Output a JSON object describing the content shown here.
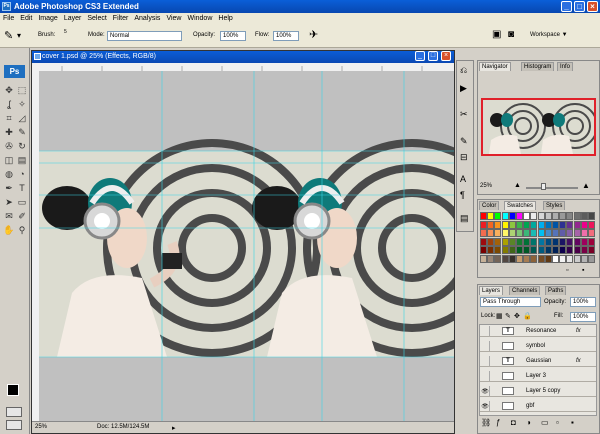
{
  "window": {
    "app_icon": "Ps",
    "title": "Adobe Photoshop CS3 Extended",
    "controls": {
      "minimize": "_",
      "maximize": "□",
      "close": "×"
    }
  },
  "menu": {
    "items": [
      "File",
      "Edit",
      "Image",
      "Layer",
      "Select",
      "Filter",
      "Analysis",
      "View",
      "Window",
      "Help"
    ]
  },
  "options": {
    "brush_label": "Brush:",
    "brush_size": "5",
    "mode_label": "Mode:",
    "mode_value": "Normal",
    "opacity_label": "Opacity:",
    "opacity_value": "100%",
    "flow_label": "Flow:",
    "flow_value": "100%",
    "workspace_label": "Workspace ▼"
  },
  "tools": {
    "logo": "Ps",
    "icons": [
      "move-icon",
      "marquee-icon",
      "lasso-icon",
      "magic-wand-icon",
      "crop-icon",
      "slice-icon",
      "healing-icon",
      "brush-icon",
      "stamp-icon",
      "history-brush-icon",
      "eraser-icon",
      "gradient-icon",
      "blur-icon",
      "dodge-icon",
      "pen-icon",
      "type-icon",
      "path-select-icon",
      "shape-icon",
      "notes-icon",
      "eyedropper-icon",
      "hand-icon",
      "zoom-icon"
    ],
    "glyphs": [
      "✥",
      "⬚",
      "ʆ",
      "✧",
      "⌗",
      "◿",
      "✚",
      "✎",
      "✇",
      "↻",
      "◫",
      "▤",
      "◍",
      "◔",
      "✒",
      "T",
      "➤",
      "▭",
      "✉",
      "✐",
      "✋",
      "⚲"
    ]
  },
  "document": {
    "tab_title": "cover 1.psd @ 25% (Effects, RGB/8)",
    "zoom": "25%",
    "doc_size": "Doc: 12.5M/124.5M"
  },
  "navigator": {
    "tabs": [
      "Navigator",
      "Histogram",
      "Info"
    ],
    "zoom": "25%"
  },
  "swatches": {
    "tabs": [
      "Color",
      "Swatches",
      "Styles"
    ],
    "colors": [
      "#ff0000",
      "#ffff00",
      "#00ff00",
      "#00ffff",
      "#0000ff",
      "#ff00ff",
      "#ffffff",
      "#ebebeb",
      "#d6d6d6",
      "#c2c2c2",
      "#adadad",
      "#999999",
      "#858585",
      "#707070",
      "#5c5c5c",
      "#474747",
      "#ed1c24",
      "#f26522",
      "#f7941d",
      "#fff200",
      "#8dc63f",
      "#39b54a",
      "#00a651",
      "#00a99d",
      "#00aeef",
      "#0072bc",
      "#0054a6",
      "#2e3192",
      "#662d91",
      "#92278f",
      "#ec008c",
      "#ed145b",
      "#f26c4f",
      "#f68e56",
      "#fbaf5d",
      "#fff568",
      "#acd373",
      "#7cc576",
      "#3bb878",
      "#1abbb4",
      "#00bff3",
      "#438ccb",
      "#5574b9",
      "#605ca8",
      "#8560a8",
      "#a763a8",
      "#f06eaa",
      "#f26d7d",
      "#9e0b0f",
      "#a0410d",
      "#a36209",
      "#aba000",
      "#598527",
      "#1a7b30",
      "#007236",
      "#00746b",
      "#0076a3",
      "#004b80",
      "#003471",
      "#1b1464",
      "#440e62",
      "#630460",
      "#9e005d",
      "#9e0039",
      "#790000",
      "#7b2e00",
      "#7d4900",
      "#827b00",
      "#406618",
      "#005e20",
      "#005826",
      "#005952",
      "#005b7f",
      "#003663",
      "#002157",
      "#0d004c",
      "#32004b",
      "#4b0049",
      "#7b0046",
      "#7a0026",
      "#c7b299",
      "#998675",
      "#736357",
      "#534741",
      "#37302a",
      "#c69c6d",
      "#a67c52",
      "#8c6239",
      "#754c24",
      "#603913",
      "#ffffff",
      "#f2f2f2",
      "#e6e6e6",
      "#cccccc",
      "#b3b3b3",
      "#999999"
    ]
  },
  "layers": {
    "tabs": [
      "Layers",
      "Channels",
      "Paths"
    ],
    "blend_mode": "Pass Through",
    "opacity_label": "Opacity:",
    "opacity_value": "100%",
    "lock_label": "Lock:",
    "fill_label": "Fill:",
    "fill_value": "100%",
    "rows": [
      {
        "name": "Resonance",
        "thumb": "T",
        "fx": "fx",
        "visible": ""
      },
      {
        "name": "symbol",
        "thumb": "",
        "fx": "",
        "visible": ""
      },
      {
        "name": "Gaussian",
        "thumb": "T",
        "fx": "fx",
        "visible": ""
      },
      {
        "name": "Layer 3",
        "thumb": "",
        "fx": "",
        "visible": ""
      },
      {
        "name": "Layer 5 copy",
        "thumb": "",
        "fx": "",
        "visible": "👁"
      },
      {
        "name": "gbf",
        "thumb": "",
        "fx": "",
        "visible": "👁"
      }
    ]
  }
}
